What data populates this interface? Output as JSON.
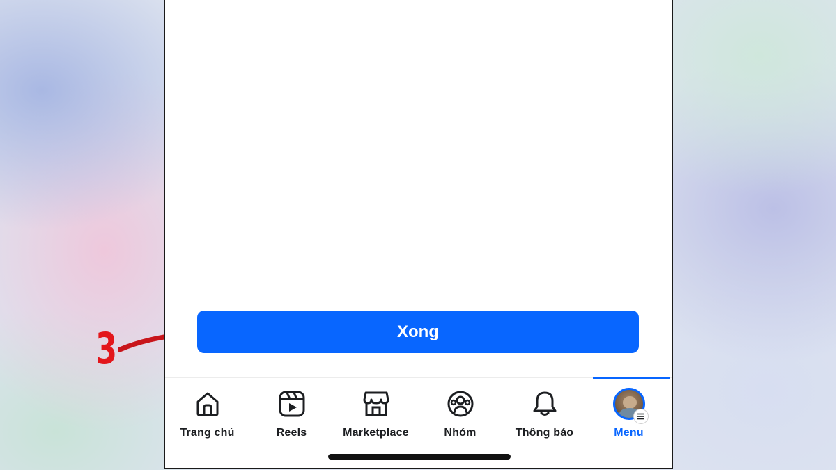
{
  "annotation": {
    "step_number": "3",
    "color": "#e3161b"
  },
  "done_button": {
    "label": "Xong",
    "color": "#0866ff"
  },
  "tabbar": {
    "active_color": "#0866ff",
    "tabs": [
      {
        "label": "Trang chủ",
        "icon": "home-icon"
      },
      {
        "label": "Reels",
        "icon": "reels-icon"
      },
      {
        "label": "Marketplace",
        "icon": "marketplace-icon"
      },
      {
        "label": "Nhóm",
        "icon": "groups-icon"
      },
      {
        "label": "Thông báo",
        "icon": "bell-icon"
      },
      {
        "label": "Menu",
        "icon": "profile-avatar-icon",
        "active": true
      }
    ]
  }
}
